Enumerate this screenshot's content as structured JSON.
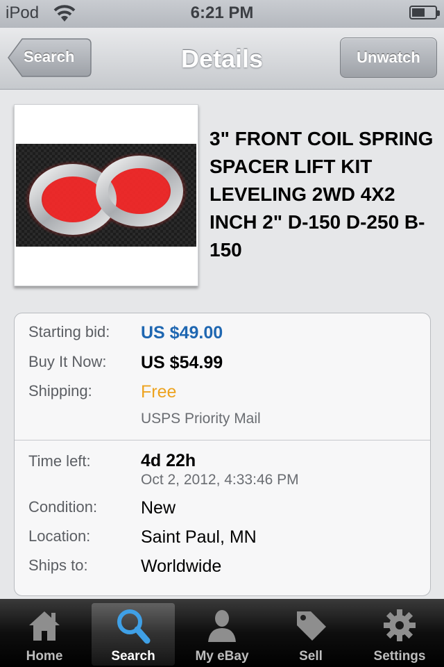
{
  "status": {
    "carrier": "iPod",
    "time": "6:21 PM"
  },
  "nav": {
    "back_label": "Search",
    "title": "Details",
    "right_button": "Unwatch"
  },
  "item": {
    "title": "3\" FRONT COIL SPRING SPACER LIFT KIT LEVELING 2WD 4X2 INCH 2\" D-150 D-250 B-150",
    "starting_bid_label": "Starting bid:",
    "starting_bid": "US $49.00",
    "buy_now_label": "Buy It Now:",
    "buy_now": "US $54.99",
    "shipping_label": "Shipping:",
    "shipping": "Free",
    "shipping_service": "USPS Priority Mail",
    "time_left_label": "Time left:",
    "time_left": "4d 22h",
    "end_time": "Oct 2, 2012, 4:33:46 PM",
    "condition_label": "Condition:",
    "condition": "New",
    "location_label": "Location:",
    "location": "Saint Paul, MN",
    "ships_to_label": "Ships to:",
    "ships_to": "Worldwide"
  },
  "colors": {
    "price_blue": "#1f67b1",
    "free_orange": "#eda31f"
  },
  "tabs": [
    {
      "label": "Home",
      "icon": "home-icon"
    },
    {
      "label": "Search",
      "icon": "search-icon",
      "active": true
    },
    {
      "label": "My eBay",
      "icon": "person-icon"
    },
    {
      "label": "Sell",
      "icon": "tag-icon"
    },
    {
      "label": "Settings",
      "icon": "gear-icon"
    }
  ]
}
